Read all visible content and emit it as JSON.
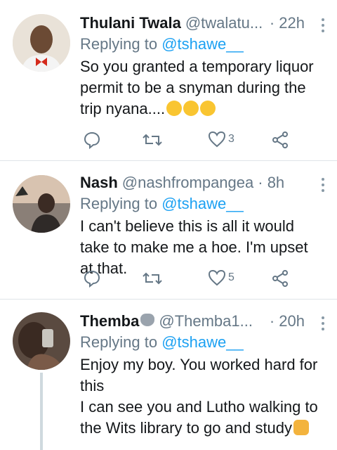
{
  "tweets": [
    {
      "name": "Thulani Twala",
      "handle": "@twalatu...",
      "time": "· 22h",
      "replying_prefix": "Replying to ",
      "replying_to": "@tshawe__",
      "text": "So you granted a temporary liquor permit to be a snyman during the trip nyana....",
      "emoji": [
        "thinking-face",
        "thinking-face",
        "thinking-face"
      ],
      "likes": "3"
    },
    {
      "name": "Nash",
      "handle": "@nashfrompangea",
      "time": "· 8h",
      "replying_prefix": "Replying to ",
      "replying_to": "@tshawe__",
      "text": "I can't believe this is all it would take to make me a hoe. I'm upset at that.",
      "likes": "5"
    },
    {
      "name": "Themba",
      "name_emoji": "wolf-face",
      "handle": "@Themba1...",
      "time": "· 20h",
      "replying_prefix": "Replying to ",
      "replying_to": "@tshawe__",
      "text_lines": [
        "Enjoy my boy. You worked hard for this",
        "I can see you and Lutho walking to the Wits library to go and study"
      ],
      "emoji": [
        "handshake"
      ]
    }
  ],
  "colors": {
    "accent": "#1da1f2",
    "muted": "#657786",
    "text": "#14171a"
  }
}
